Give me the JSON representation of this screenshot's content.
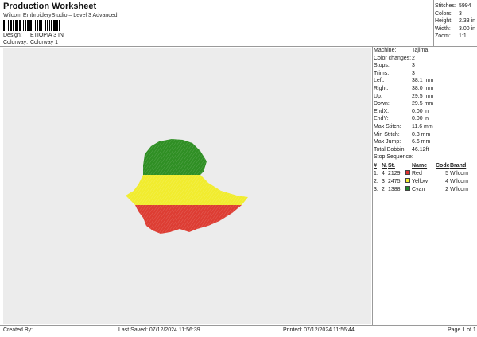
{
  "header": {
    "title": "Production Worksheet",
    "subtitle": "Wilcom EmbroideryStudio – Level 3 Advanced"
  },
  "meta": {
    "design_label": "Design:",
    "design_value": "ETIOPIA 3 IN",
    "colorway_label": "Colorway:",
    "colorway_value": "Colorway 1"
  },
  "top_stats": [
    {
      "label": "Stitches:",
      "value": "5994"
    },
    {
      "label": "Colors:",
      "value": "3"
    },
    {
      "label": "Height:",
      "value": "2.33 in"
    },
    {
      "label": "Width:",
      "value": "3.00 in"
    },
    {
      "label": "Zoom:",
      "value": "1:1"
    }
  ],
  "machine_stats": [
    {
      "label": "Machine:",
      "value": "Tajima"
    },
    {
      "label": "Color changes:",
      "value": "2"
    },
    {
      "label": "Stops:",
      "value": "3"
    },
    {
      "label": "Trims:",
      "value": "3"
    },
    {
      "label": "Left:",
      "value": "38.1 mm"
    },
    {
      "label": "Right:",
      "value": "38.0 mm"
    },
    {
      "label": "Up:",
      "value": "29.5 mm"
    },
    {
      "label": "Down:",
      "value": "29.5 mm"
    },
    {
      "label": "EndX:",
      "value": "0.00 in"
    },
    {
      "label": "EndY:",
      "value": "0.00 in"
    },
    {
      "label": "Max Stitch:",
      "value": "11.6 mm"
    },
    {
      "label": "Min Stitch:",
      "value": "0.3 mm"
    },
    {
      "label": "Max Jump:",
      "value": "6.6 mm"
    },
    {
      "label": "Total Bobbin:",
      "value": "46.12ft"
    }
  ],
  "stop_sequence": {
    "title": "Stop Sequence:",
    "headers": {
      "num": "#",
      "n": "N.",
      "st": "St.",
      "code": "Code",
      "name": "Name",
      "code2": "Code",
      "brand": "Brand"
    },
    "rows": [
      {
        "num": "1.",
        "n": "4",
        "stitches": "2129",
        "color": "#e03030",
        "name": "Red",
        "code": "5",
        "brand": "Wilcom"
      },
      {
        "num": "2.",
        "n": "3",
        "stitches": "2475",
        "color": "#f5ee30",
        "name": "Yellow",
        "code": "4",
        "brand": "Wilcom"
      },
      {
        "num": "3.",
        "n": "2",
        "stitches": "1388",
        "color": "#1f8a2e",
        "name": "Cyan",
        "code": "2",
        "brand": "Wilcom"
      }
    ]
  },
  "footer": {
    "created_by": "Created By:",
    "last_saved": "Last Saved: 07/12/2024 11:56:39",
    "printed": "Printed: 07/12/2024 11:56:44",
    "page": "Page 1 of 1"
  },
  "colors": {
    "green": "#2f8f24",
    "yellow": "#f1ec2e",
    "red": "#dd3d33",
    "canvas": "#ececec"
  }
}
